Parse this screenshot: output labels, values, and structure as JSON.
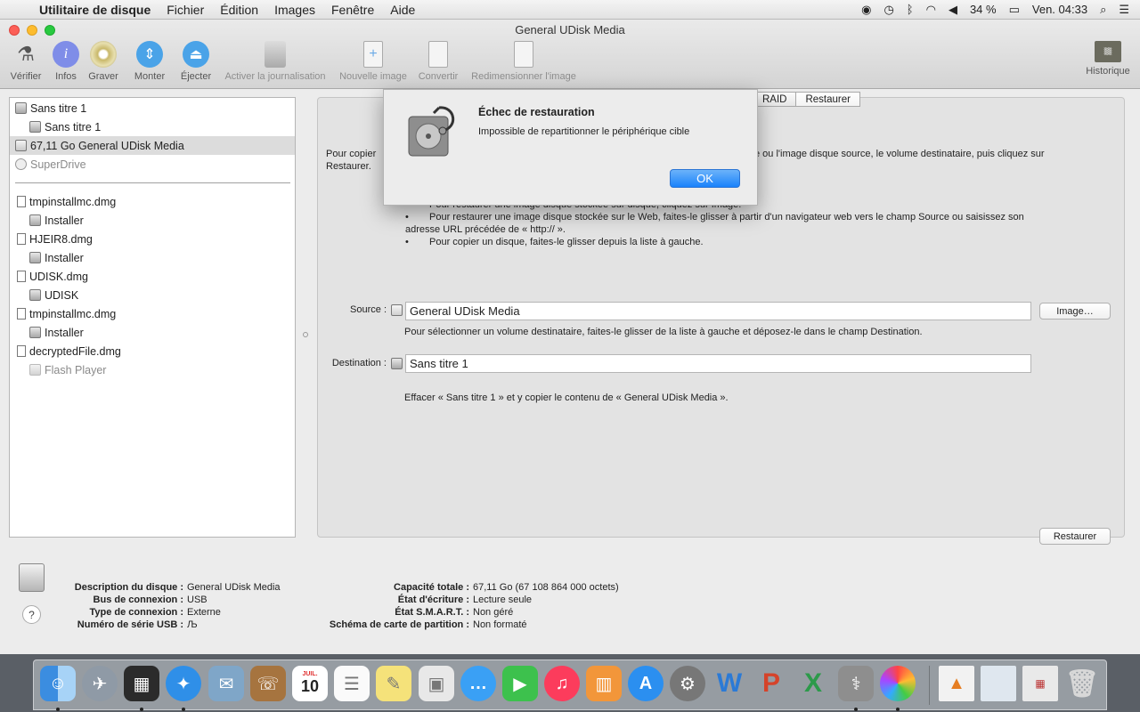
{
  "menubar": {
    "app_name": "Utilitaire de disque",
    "items": [
      "Fichier",
      "Édition",
      "Images",
      "Fenêtre",
      "Aide"
    ],
    "battery": "34 %",
    "clock": "Ven. 04:33"
  },
  "window": {
    "title": "General UDisk Media"
  },
  "toolbar": {
    "verify": "Vérifier",
    "info": "Infos",
    "burn": "Graver",
    "mount": "Monter",
    "eject": "Éjecter",
    "journal": "Activer la journalisation",
    "new_image": "Nouvelle image",
    "convert": "Convertir",
    "resize": "Redimensionner l'image",
    "history": "Historique"
  },
  "sidebar": {
    "items": [
      "Sans titre 1",
      "Sans titre 1",
      "67,11 Go General UDisk Media",
      "SuperDrive",
      "tmpinstallmc.dmg",
      "Installer",
      "HJEIR8.dmg",
      "Installer",
      "UDISK.dmg",
      "UDISK",
      "tmpinstallmc.dmg",
      "Installer",
      "decryptedFile.dmg",
      "Flash Player"
    ]
  },
  "tabs": {
    "raid": "RAID",
    "restore": "Restaurer"
  },
  "restore": {
    "intro_left": "Pour copier",
    "intro_right": "e ou l'image disque source, le volume destinataire, puis cliquez sur",
    "intro_line2": "Restaurer.",
    "bullet1": "Pour restaurer une image disque stockée sur disque, cliquez sur Image.",
    "bullet2a": "Pour restaurer une image disque stockée sur le Web, faites-le glisser à partir d'un navigateur web vers le champ Source ou saisissez son",
    "bullet2b": "adresse URL précédée de « http:// ».",
    "bullet3": "Pour copier un disque, faites-le glisser depuis la liste à gauche.",
    "source_label": "Source :",
    "source_value": "General UDisk Media",
    "image_button": "Image…",
    "dest_hint": "Pour sélectionner un volume destinataire, faites-le glisser de la liste à gauche et déposez-le dans le champ Destination.",
    "dest_label": "Destination :",
    "dest_value": "Sans titre 1",
    "summary": "Effacer « Sans titre 1 » et y copier le contenu de « General UDisk Media ».",
    "restore_button": "Restaurer"
  },
  "info": {
    "left": [
      {
        "k": "Description du disque :",
        "v": "General UDisk Media"
      },
      {
        "k": "Bus de connexion :",
        "v": "USB"
      },
      {
        "k": "Type de connexion :",
        "v": "Externe"
      },
      {
        "k": "Numéro de série USB :",
        "v": "Љ"
      }
    ],
    "right": [
      {
        "k": "Capacité totale :",
        "v": "67,11 Go (67 108 864 000 octets)"
      },
      {
        "k": "État d'écriture :",
        "v": "Lecture seule"
      },
      {
        "k": "État S.M.A.R.T. :",
        "v": "Non géré"
      },
      {
        "k": "Schéma de carte de partition :",
        "v": "Non formaté"
      }
    ],
    "help": "?"
  },
  "dialog": {
    "title": "Échec de restauration",
    "message": "Impossible de repartitionner le périphérique cible",
    "ok": "OK"
  },
  "dock": {
    "calendar_day": "10",
    "calendar_month": "JUIL."
  },
  "colors": {
    "accent": "#1a82fb",
    "selection": "#dcdcdc"
  }
}
